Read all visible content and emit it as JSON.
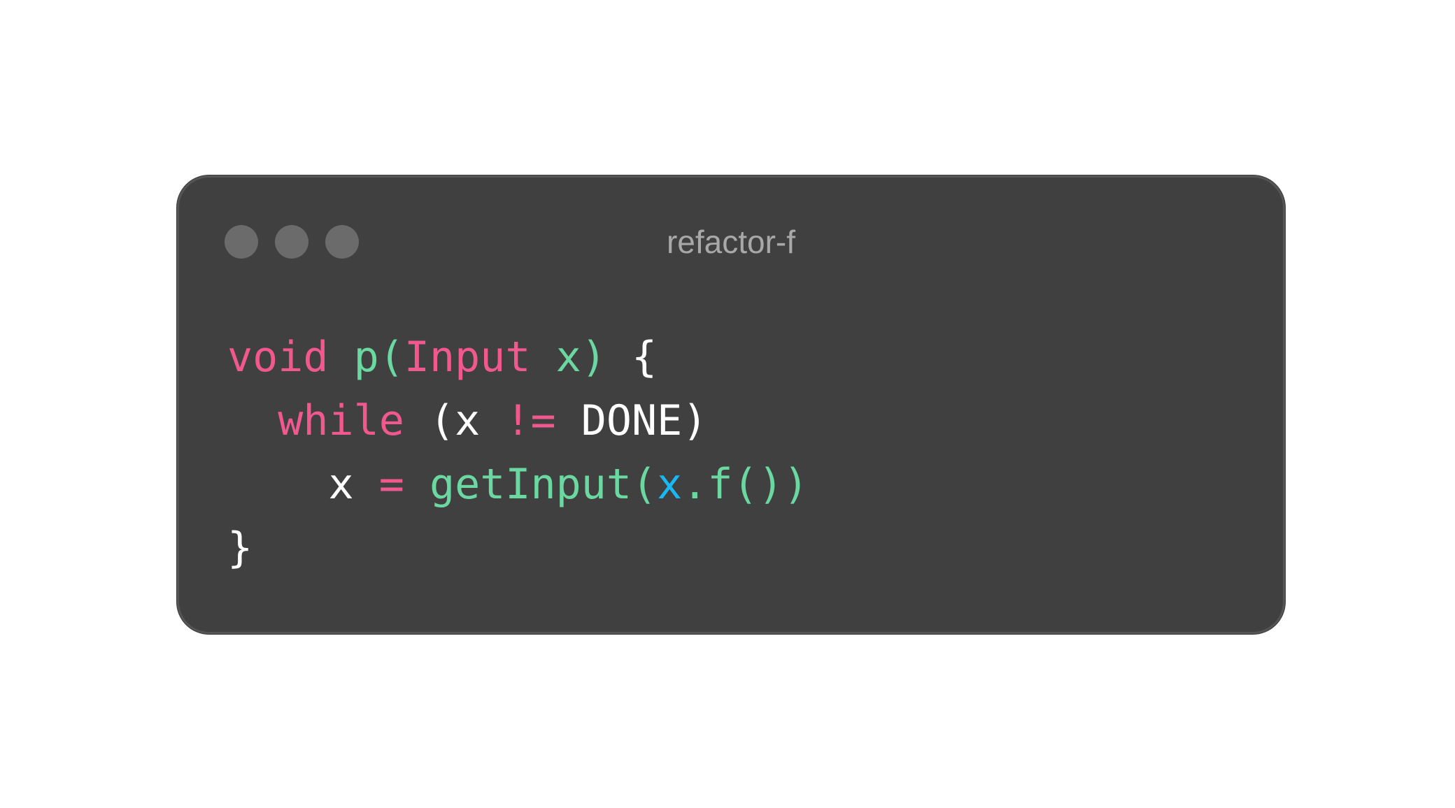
{
  "window": {
    "title": "refactor-f",
    "dots": [
      "window-dot",
      "window-dot",
      "window-dot"
    ]
  },
  "code": {
    "lines": [
      [
        {
          "text": "void",
          "kind": "kw"
        },
        {
          "text": " ",
          "kind": "plain"
        },
        {
          "text": "p(",
          "kind": "fn"
        },
        {
          "text": "Input",
          "kind": "kw"
        },
        {
          "text": " x)",
          "kind": "fn"
        },
        {
          "text": " {",
          "kind": "plain"
        }
      ],
      [
        {
          "text": "  ",
          "kind": "plain"
        },
        {
          "text": "while",
          "kind": "kw"
        },
        {
          "text": " (x ",
          "kind": "plain"
        },
        {
          "text": "!=",
          "kind": "kw"
        },
        {
          "text": " DONE)",
          "kind": "plain"
        }
      ],
      [
        {
          "text": "    x ",
          "kind": "plain"
        },
        {
          "text": "=",
          "kind": "kw"
        },
        {
          "text": " ",
          "kind": "plain"
        },
        {
          "text": "getInput(",
          "kind": "fn"
        },
        {
          "text": "x",
          "kind": "var"
        },
        {
          "text": ".f())",
          "kind": "fn"
        }
      ],
      [
        {
          "text": "}",
          "kind": "plain"
        }
      ]
    ]
  },
  "colors": {
    "background": "#ffffff",
    "window": "#404040",
    "keyword": "#f0588e",
    "function": "#6ad8a0",
    "plain": "#ffffff",
    "variable": "#1ab8f0",
    "title": "#a8a8a8",
    "dot": "#6b6b6b"
  }
}
